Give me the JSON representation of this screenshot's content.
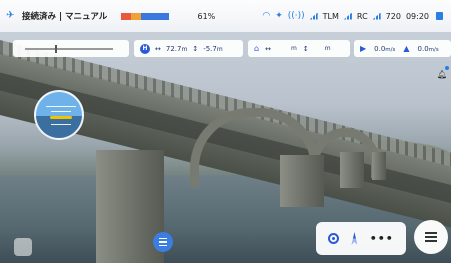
{
  "status": {
    "connection_text": "接続済み | マニュアル",
    "battery_percent_label": "61%",
    "battery_segments": [
      "#e65b3a",
      "#f0a23a",
      "#3a78e0",
      "#3a78e0"
    ],
    "signal_label": "TLM",
    "rc_label": "RC",
    "resolution": "720",
    "time": "09:20"
  },
  "telemetry": {
    "home_distance": "72.7",
    "home_distance_unit": "m",
    "home_height": "-5.7",
    "home_height_unit": "m",
    "drone_distance_unit": "m",
    "drone_height_unit": "m",
    "h_speed": "0.0",
    "h_speed_unit": "m/s",
    "v_speed": "0.0",
    "v_speed_unit": "m/s",
    "home_badge": "H"
  },
  "colors": {
    "accent": "#2a5ad8",
    "sky": "#6fb2ea"
  }
}
